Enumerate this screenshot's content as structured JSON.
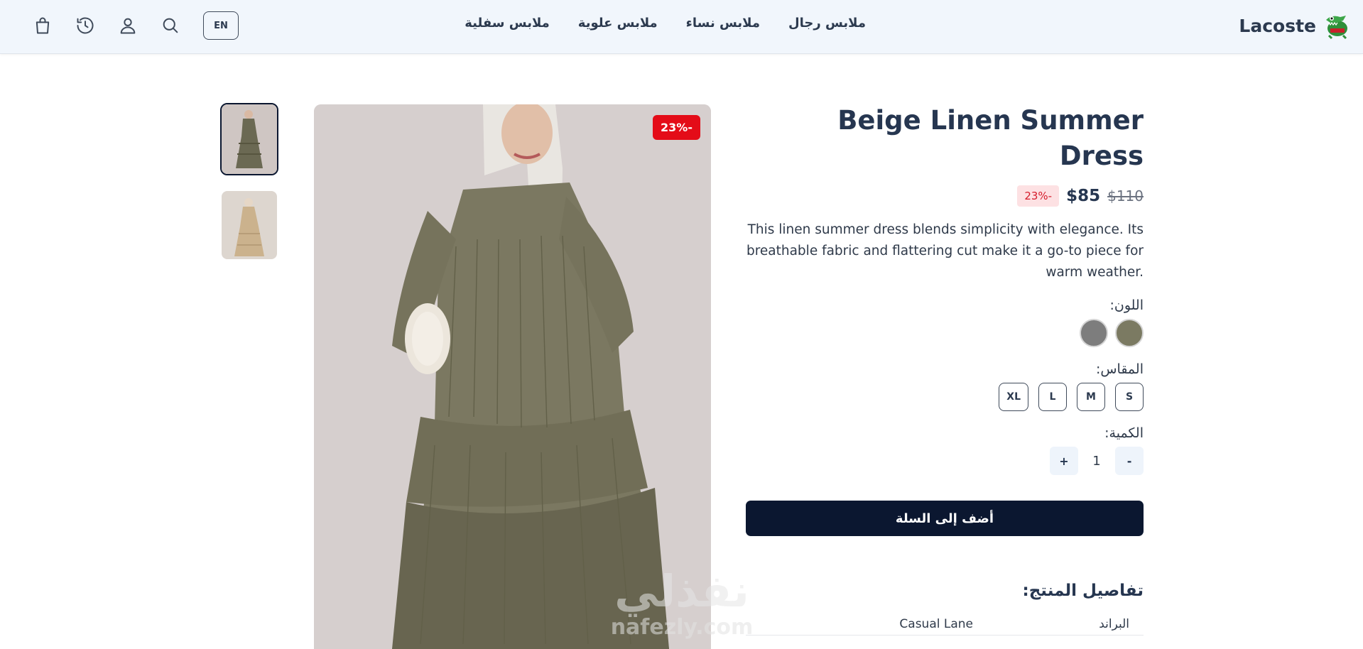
{
  "header": {
    "brand": "Lacoste",
    "nav": [
      "ملابس رجال",
      "ملابس نساء",
      "ملابس علوية",
      "ملابس سفلية"
    ],
    "lang": "EN",
    "icons": [
      "cart-icon",
      "history-icon",
      "user-icon",
      "search-icon"
    ]
  },
  "gallery": {
    "badge": "23%-",
    "watermark_ar": "نفذلي",
    "watermark_en": "nafezly.com"
  },
  "product": {
    "title": "Beige Linen Summer Dress",
    "old_price": "$110",
    "price": "$85",
    "discount": "23%-",
    "description": "This linen summer dress blends simplicity with elegance. Its breathable fabric and flattering cut make it a go-to piece for warm weather.",
    "color_label": "اللون:",
    "colors": [
      "#7b7a62",
      "#7d7d7d"
    ],
    "size_label": "المقاس:",
    "sizes": [
      "S",
      "M",
      "L",
      "XL"
    ],
    "quantity_label": "الكمية:",
    "quantity": "1",
    "minus": "-",
    "plus": "+",
    "add_to_cart": "أضف إلى السلة",
    "details_title": "تفاصيل المنتج:",
    "specs": [
      {
        "key": "البراند",
        "value": "Casual Lane"
      }
    ]
  }
}
